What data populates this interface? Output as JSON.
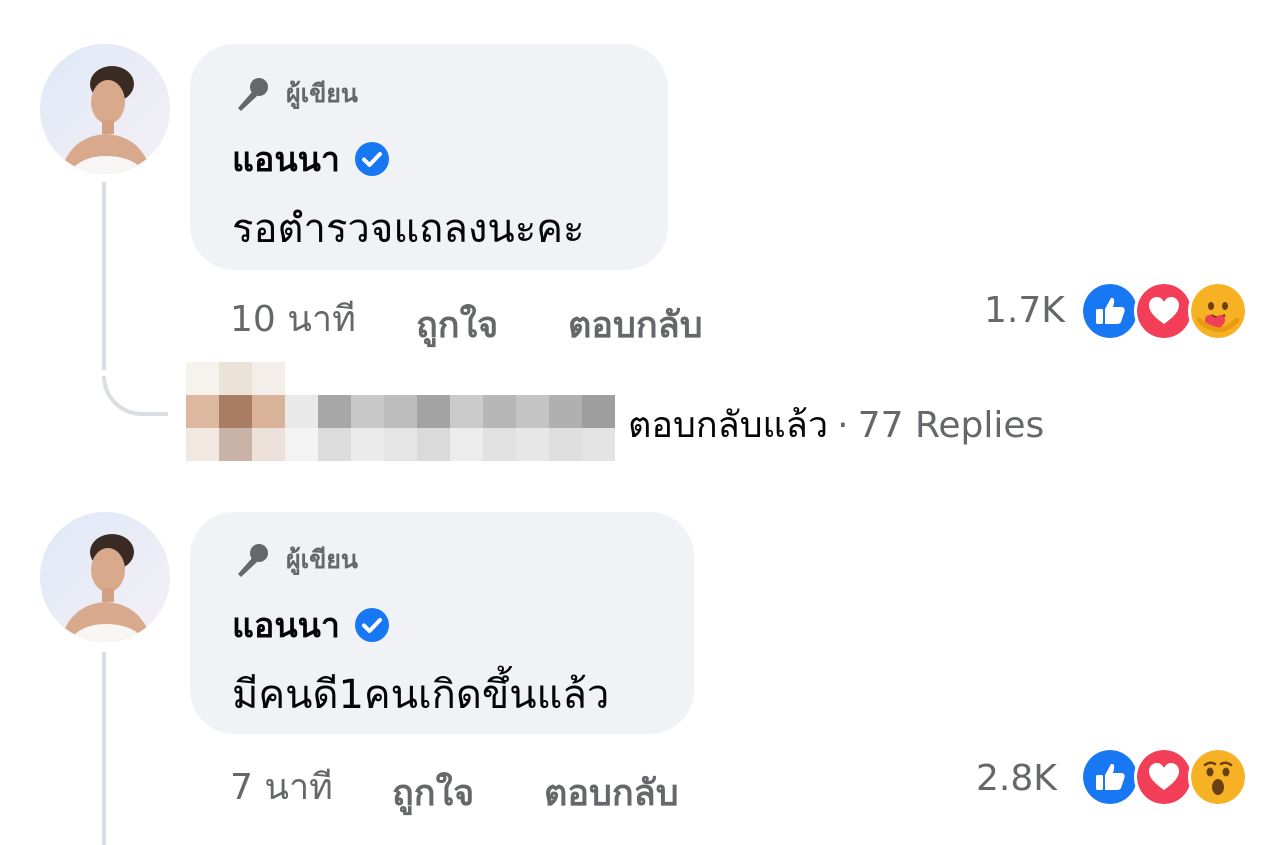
{
  "comments": [
    {
      "badge": "ผู้เขียน",
      "author": "แอนนา",
      "text": "รอตำรวจแถลงนะคะ",
      "time": "10 นาที",
      "like_label": "ถูกใจ",
      "reply_label": "ตอบกลับ",
      "reaction_count": "1.7K",
      "reactions": [
        "like-icon",
        "love-icon",
        "care-icon"
      ]
    },
    {
      "badge": "ผู้เขียน",
      "author": "แอนนา",
      "text": "มีคนดี1คนเกิดขึ้นแล้ว",
      "time": "7 นาที",
      "like_label": "ถูกใจ",
      "reply_label": "ตอบกลับ",
      "reaction_count": "2.8K",
      "reactions": [
        "like-icon",
        "love-icon",
        "wow-icon"
      ]
    }
  ],
  "reply_summary": {
    "replied_label": "ตอบกลับแล้ว",
    "separator": "·",
    "replies_count": "77 Replies"
  },
  "colors": {
    "bubble": "#f0f2f5",
    "meta_text": "#65676b",
    "verified": "#1877f2",
    "like": "#1877f2",
    "love": "#f33e58",
    "care": "#f7b125"
  }
}
